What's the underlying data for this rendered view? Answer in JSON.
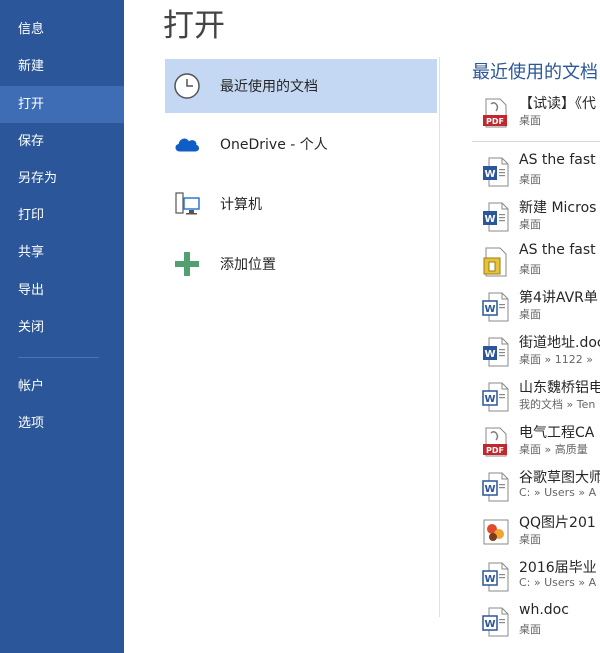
{
  "sidebar": {
    "items": [
      {
        "label": "信息"
      },
      {
        "label": "新建"
      },
      {
        "label": "打开"
      },
      {
        "label": "保存"
      },
      {
        "label": "另存为"
      },
      {
        "label": "打印"
      },
      {
        "label": "共享"
      },
      {
        "label": "导出"
      },
      {
        "label": "关闭"
      },
      {
        "label": "帐户"
      },
      {
        "label": "选项"
      }
    ],
    "colors": {
      "background": "#2b579a",
      "active": "#3e6db5"
    }
  },
  "page": {
    "title": "打开"
  },
  "places": {
    "items": [
      {
        "label": "最近使用的文档",
        "icon": "clock-icon"
      },
      {
        "label": "OneDrive - 个人",
        "icon": "cloud-icon"
      },
      {
        "label": "计算机",
        "icon": "computer-icon"
      },
      {
        "label": "添加位置",
        "icon": "plus-icon"
      }
    ]
  },
  "recent": {
    "title": "最近使用的文档",
    "files": [
      {
        "name": "【试读】《代",
        "path": "桌面",
        "icon": "pdf-icon"
      },
      {
        "name": "AS the fast",
        "path": "桌面",
        "icon": "word-doc-icon"
      },
      {
        "name": "新建 Micros",
        "path": "桌面",
        "icon": "word-doc-icon"
      },
      {
        "name": "AS the fast",
        "path": "桌面",
        "icon": "generic-file-icon"
      },
      {
        "name": "第4讲AVR单",
        "path": "桌面",
        "icon": "word-legacy-icon"
      },
      {
        "name": "街道地址.doc",
        "path": "桌面 » 1122 »",
        "icon": "word-doc-icon"
      },
      {
        "name": "山东魏桥铝电",
        "path": "我的文档 » Ten",
        "icon": "word-legacy-icon"
      },
      {
        "name": "电气工程CA",
        "path": "桌面 » 高质量",
        "icon": "pdf-icon"
      },
      {
        "name": "谷歌草图大师",
        "path": "C: » Users » A",
        "icon": "word-legacy-icon"
      },
      {
        "name": "QQ图片201",
        "path": "桌面",
        "icon": "image-icon"
      },
      {
        "name": "2016届毕业",
        "path": "C: » Users » A",
        "icon": "word-legacy-icon"
      },
      {
        "name": "wh.doc",
        "path": "桌面",
        "icon": "word-legacy-icon"
      }
    ]
  }
}
